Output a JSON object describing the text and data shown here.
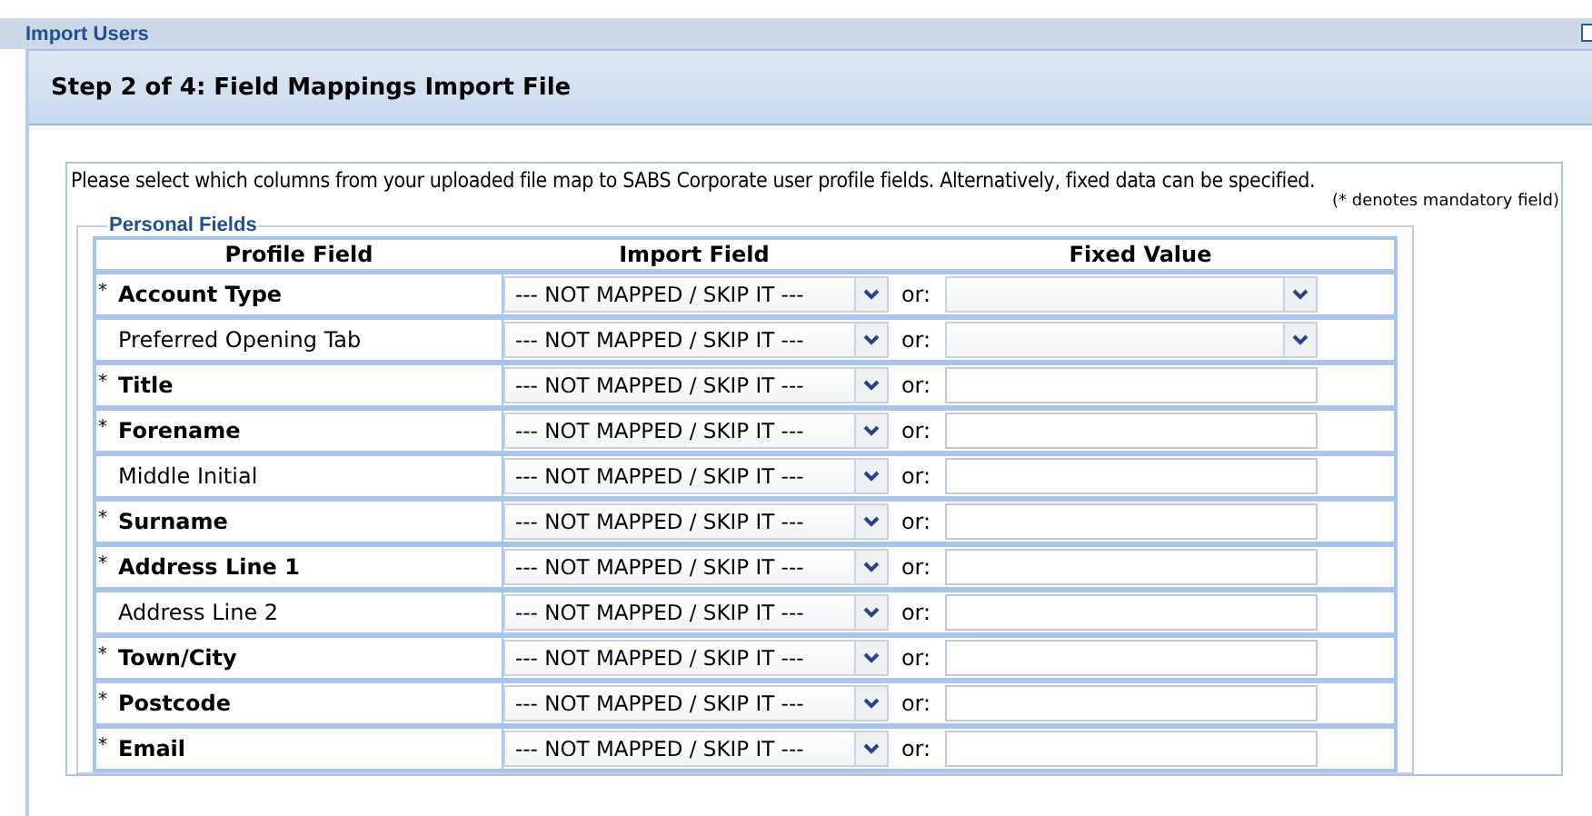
{
  "page_title": "Import Users",
  "step_title": "Step 2 of 4: Field Mappings Import File",
  "intro": "Please select which columns from your uploaded file map to SABS Corporate user profile fields. Alternatively, fixed data can be specified.",
  "mandatory_note": "(* denotes mandatory field)",
  "fieldset_legend": "Personal Fields",
  "columns": [
    "Profile Field",
    "Import Field",
    "Fixed Value"
  ],
  "rows": [
    {
      "mark": "*",
      "label": "Account Type",
      "mandatory": true,
      "import_value": "--- NOT MAPPED / SKIP IT ---",
      "or_label": "or:",
      "kind": "select"
    },
    {
      "label": "Preferred Opening Tab",
      "mandatory": false,
      "import_value": "--- NOT MAPPED / SKIP IT ---",
      "or_label": "or:",
      "kind": "select"
    },
    {
      "mark": "*",
      "label": "Title",
      "mandatory": true,
      "import_value": "--- NOT MAPPED / SKIP IT ---",
      "or_label": "or:",
      "kind": "text"
    },
    {
      "mark": "*",
      "label": "Forename",
      "mandatory": true,
      "import_value": "--- NOT MAPPED / SKIP IT ---",
      "or_label": "or:",
      "kind": "text"
    },
    {
      "label": "Middle Initial",
      "mandatory": false,
      "import_value": "--- NOT MAPPED / SKIP IT ---",
      "or_label": "or:",
      "kind": "text"
    },
    {
      "mark": "*",
      "label": "Surname",
      "mandatory": true,
      "import_value": "--- NOT MAPPED / SKIP IT ---",
      "or_label": "or:",
      "kind": "text"
    },
    {
      "mark": "*",
      "label": "Address Line 1",
      "mandatory": true,
      "import_value": "--- NOT MAPPED / SKIP IT ---",
      "or_label": "or:",
      "kind": "text"
    },
    {
      "label": "Address Line 2",
      "mandatory": false,
      "import_value": "--- NOT MAPPED / SKIP IT ---",
      "or_label": "or:",
      "kind": "text"
    },
    {
      "mark": "*",
      "label": "Town/City",
      "mandatory": true,
      "import_value": "--- NOT MAPPED / SKIP IT ---",
      "or_label": "or:",
      "kind": "text"
    },
    {
      "mark": "*",
      "label": "Postcode",
      "mandatory": true,
      "import_value": "--- NOT MAPPED / SKIP IT ---",
      "or_label": "or:",
      "kind": "text"
    },
    {
      "mark": "*",
      "label": "Email",
      "mandatory": true,
      "import_value": "--- NOT MAPPED / SKIP IT ---",
      "or_label": "or:",
      "kind": "text"
    }
  ]
}
